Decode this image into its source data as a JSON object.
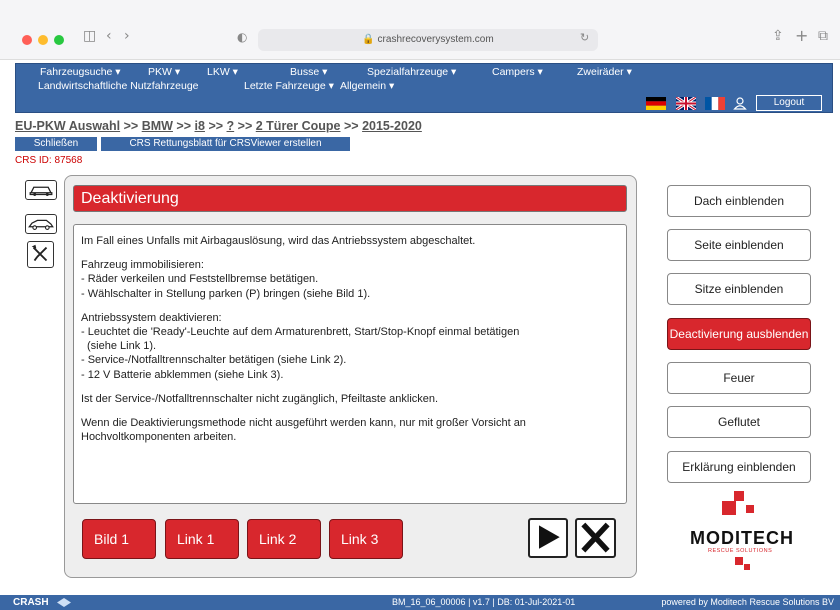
{
  "browser": {
    "url": "crashrecoverysystem.com"
  },
  "menu": {
    "items": [
      "Fahrzeugsuche ▾",
      "PKW ▾",
      "LKW ▾",
      "Busse ▾",
      "Spezialfahrzeuge ▾",
      "Campers ▾",
      "Zweiräder ▾",
      "Landwirtschaftliche Nutzfahrzeuge",
      "Letzte Fahrzeuge ▾",
      "Allgemein ▾"
    ],
    "logout": "Logout"
  },
  "breadcrumb": {
    "root": "EU-PKW Auswahl",
    "sep": ">>",
    "b1": "BMW",
    "b2": "i8",
    "b3": "?",
    "b4": "2 Türer Coupe",
    "b5": "2015-2020"
  },
  "subbar": {
    "close": "Schließen",
    "crs": "CRS Rettungsblatt für CRSViewer erstellen"
  },
  "crs_id": "CRS ID: 87568",
  "panel": {
    "title": "Deaktivierung",
    "p1": "Im Fall eines Unfalls mit Airbagauslösung, wird das Antriebssystem abgeschaltet.",
    "p2": [
      "Fahrzeug immobilisieren:",
      "- Räder verkeilen und Feststellbremse betätigen.",
      "- Wählschalter in Stellung parken (P) bringen (siehe Bild 1)."
    ],
    "p3": [
      "Antriebssystem deaktivieren:",
      "- Leuchtet die 'Ready'-Leuchte auf dem Armaturenbrett, Start/Stop-Knopf einmal betätigen",
      "  (siehe Link 1).",
      "- Service-/Notfalltrennschalter betätigen (siehe Link 2).",
      "- 12 V Batterie abklemmen (siehe Link 3)."
    ],
    "p4": "Ist der Service-/Notfalltrennschalter nicht zugänglich, Pfeiltaste anklicken.",
    "p5": [
      "Wenn die Deaktivierungsmethode nicht ausgeführt werden kann, nur mit großer Vorsicht an",
      "Hochvoltkomponenten arbeiten."
    ],
    "buttons": [
      "Bild 1",
      "Link 1",
      "Link 2",
      "Link 3"
    ]
  },
  "side_buttons": [
    "Dach einblenden",
    "Seite einblenden",
    "Sitze einblenden",
    "Deactivierung ausblenden",
    "Feuer",
    "Geflutet",
    "Erklärung einblenden"
  ],
  "logo": {
    "name": "MODITECH",
    "tagline": "RESCUE SOLUTIONS"
  },
  "footer": {
    "brand": "CRASH",
    "center": "BM_16_06_00006 | v1.7 | DB: 01-Jul-2021-01",
    "right": "powered by Moditech Rescue Solutions BV"
  },
  "colors": {
    "accent_blue": "#3a67a4",
    "accent_red": "#d8272d"
  }
}
